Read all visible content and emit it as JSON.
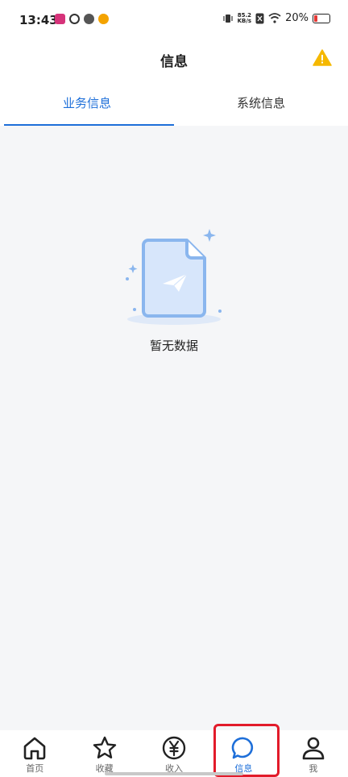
{
  "status_bar": {
    "time": "13:43",
    "net_speed_value": "85.2",
    "net_speed_unit": "KB/s",
    "battery": "20%"
  },
  "header": {
    "title": "信息"
  },
  "tabs": [
    {
      "label": "业务信息",
      "active": true
    },
    {
      "label": "系统信息",
      "active": false
    }
  ],
  "empty_state": {
    "text": "暂无数据"
  },
  "bottom_nav": [
    {
      "label": "首页",
      "icon": "home-icon"
    },
    {
      "label": "收藏",
      "icon": "star-icon"
    },
    {
      "label": "收入",
      "icon": "yen-icon"
    },
    {
      "label": "信息",
      "icon": "message-icon",
      "active": true
    },
    {
      "label": "我",
      "icon": "user-icon"
    }
  ],
  "colors": {
    "accent": "#1e6fd9",
    "warning": "#f5b800",
    "highlight": "#e21b2a",
    "background": "#f5f6f8"
  }
}
